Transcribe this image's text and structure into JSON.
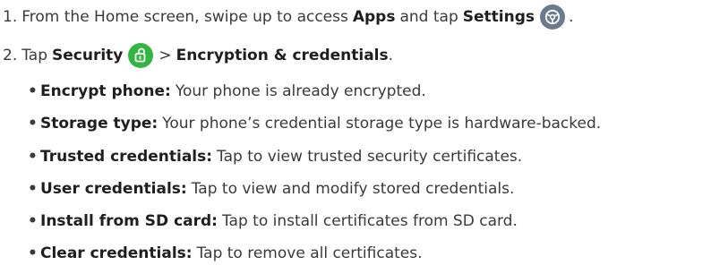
{
  "steps": [
    {
      "number": "1.",
      "text_a": "From the Home screen, swipe up to access",
      "bold_a": "Apps",
      "text_b": "and tap",
      "bold_b": "Settings",
      "icon": "settings-icon",
      "end": "."
    },
    {
      "number": "2.",
      "text_a": "Tap",
      "bold_a": "Security",
      "icon": "security-lock-icon",
      "sep": ">",
      "bold_b": "Encryption & credentials",
      "end": "."
    }
  ],
  "bullets": [
    {
      "term": "Encrypt phone:",
      "desc": "Your phone is already encrypted."
    },
    {
      "term": "Storage type:",
      "desc": "Your phone’s credential storage type is hardware-backed."
    },
    {
      "term": "Trusted credentials:",
      "desc": "Tap to view trusted security certificates."
    },
    {
      "term": "User credentials:",
      "desc": "Tap to view and modify stored credentials."
    },
    {
      "term": "Install from SD card:",
      "desc": "Tap to install certificates from SD card."
    },
    {
      "term": "Clear credentials:",
      "desc": "Tap to remove all certificates."
    }
  ],
  "bullet_char": "•",
  "colors": {
    "text": "#3a3a3a",
    "bold_text": "#1f1f1f",
    "settings_icon_bg": "#6c7a8e",
    "security_icon_bg": "#33b544"
  }
}
